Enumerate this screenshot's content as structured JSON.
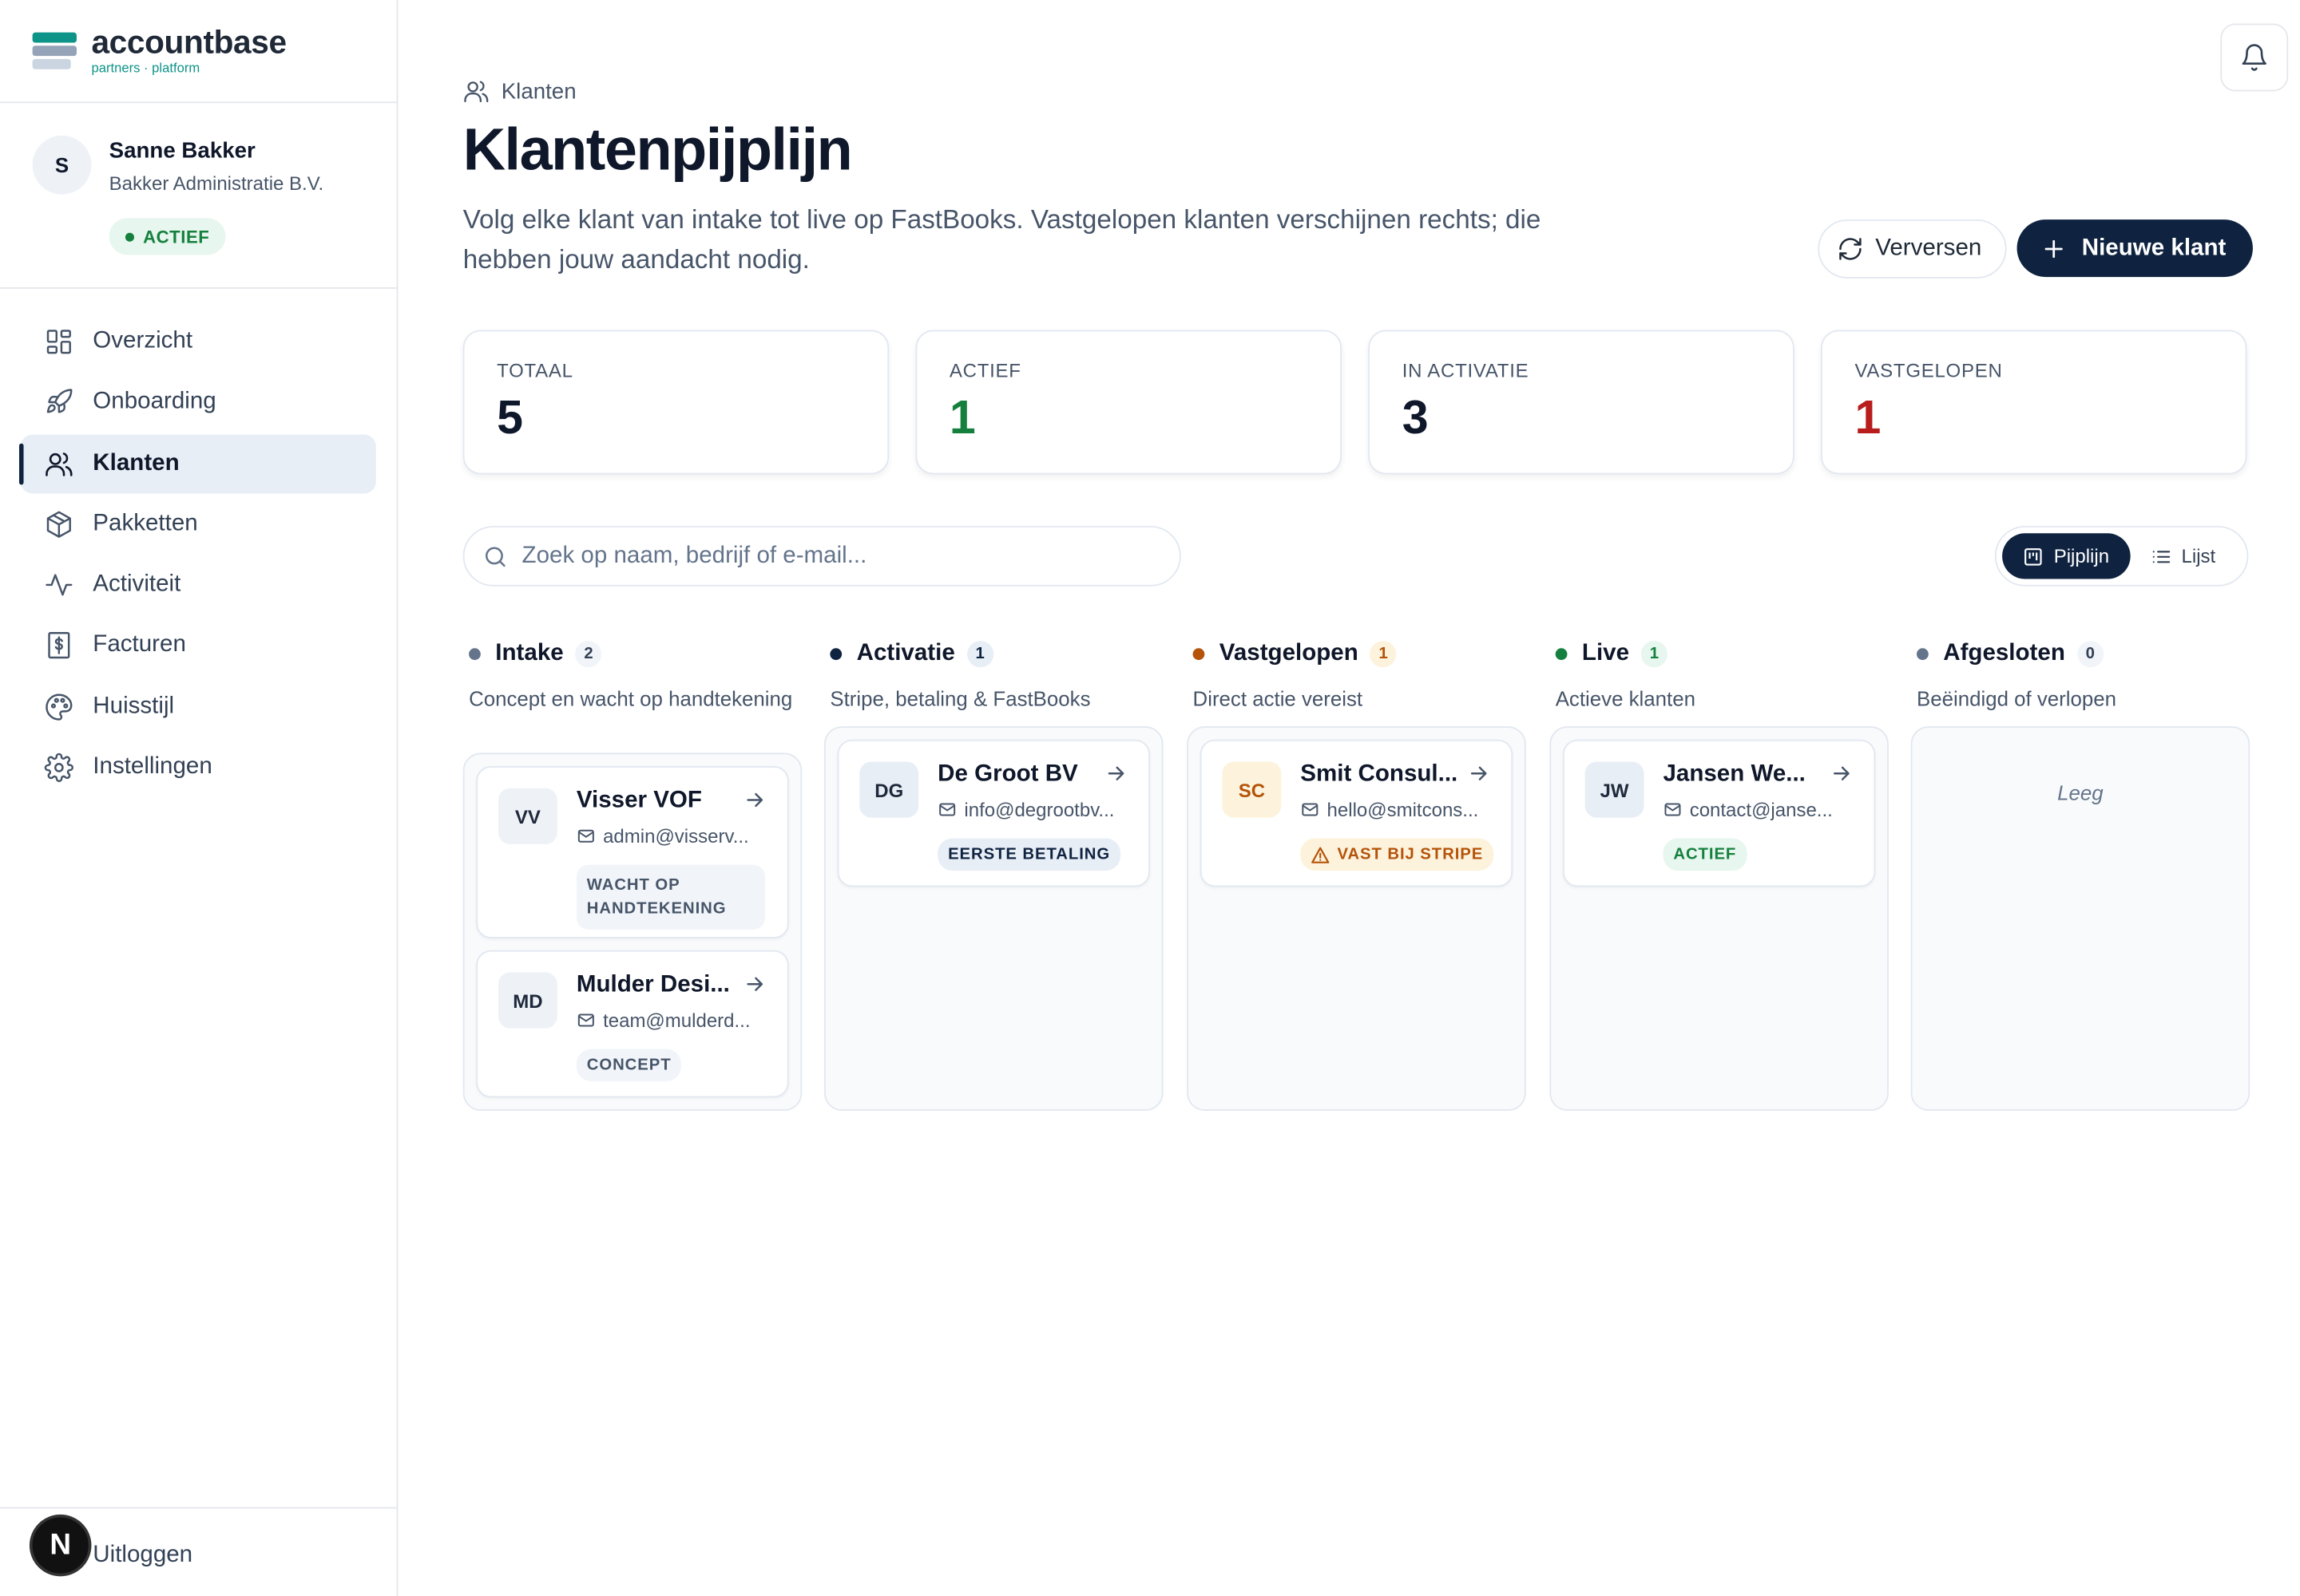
{
  "brand": {
    "name": "accountbase",
    "tagline": "partners · platform"
  },
  "user": {
    "initial": "S",
    "name": "Sanne Bakker",
    "org": "Bakker Administratie B.V.",
    "status": "ACTIEF"
  },
  "nav": {
    "items": [
      {
        "label": "Overzicht",
        "icon": "grid-icon"
      },
      {
        "label": "Onboarding",
        "icon": "rocket-icon"
      },
      {
        "label": "Klanten",
        "icon": "users-icon",
        "active": true
      },
      {
        "label": "Pakketten",
        "icon": "package-icon"
      },
      {
        "label": "Activiteit",
        "icon": "activity-icon"
      },
      {
        "label": "Facturen",
        "icon": "receipt-icon"
      },
      {
        "label": "Huisstijl",
        "icon": "palette-icon"
      },
      {
        "label": "Instellingen",
        "icon": "gear-icon"
      }
    ],
    "logout": "Uitloggen",
    "dev_badge": "N"
  },
  "header": {
    "breadcrumb": "Klanten",
    "title": "Klantenpijplijn",
    "subtitle": "Volg elke klant van intake tot live op FastBooks. Vastgelopen klanten verschijnen rechts; die hebben jouw aandacht nodig.",
    "refresh_label": "Verversen",
    "new_label": "Nieuwe klant"
  },
  "stats": [
    {
      "label": "TOTAAL",
      "value": "5",
      "color": "#0f172a"
    },
    {
      "label": "ACTIEF",
      "value": "1",
      "color": "#15803d"
    },
    {
      "label": "IN ACTIVATIE",
      "value": "3",
      "color": "#0f172a"
    },
    {
      "label": "VASTGELOPEN",
      "value": "1",
      "color": "#b91c1c"
    }
  ],
  "search": {
    "placeholder": "Zoek op naam, bedrijf of e-mail..."
  },
  "view_toggle": {
    "board": "Pijplijn",
    "list": "Lijst",
    "selected": "Pijplijn"
  },
  "columns": [
    {
      "name": "Intake",
      "count": "2",
      "description": "Concept en wacht op handtekening",
      "dot": "#64748b",
      "cards": [
        {
          "initials": "VV",
          "name": "Visser VOF",
          "email": "admin@visserv...",
          "status": "WACHT OP HANDTEKENING"
        },
        {
          "initials": "MD",
          "name": "Mulder Desi...",
          "email": "team@mulderd...",
          "status": "CONCEPT"
        }
      ]
    },
    {
      "name": "Activatie",
      "count": "1",
      "description": "Stripe, betaling & FastBooks",
      "dot": "#0f2340",
      "cards": [
        {
          "initials": "DG",
          "name": "De Groot BV",
          "email": "info@degrootbv...",
          "status": "EERSTE BETALING"
        }
      ]
    },
    {
      "name": "Vastgelopen",
      "count": "1",
      "description": "Direct actie vereist",
      "dot": "#b45309",
      "cards": [
        {
          "initials": "SC",
          "name": "Smit Consul...",
          "email": "hello@smitcons...",
          "status": "VAST BIJ STRIPE"
        }
      ]
    },
    {
      "name": "Live",
      "count": "1",
      "description": "Actieve klanten",
      "dot": "#15803d",
      "cards": [
        {
          "initials": "JW",
          "name": "Jansen We...",
          "email": "contact@janse...",
          "status": "ACTIEF"
        }
      ]
    },
    {
      "name": "Afgesloten",
      "count": "0",
      "description": "Beëindigd of verlopen",
      "dot": "#64748b",
      "cards": [],
      "empty_label": "Leeg"
    }
  ],
  "colors": {
    "primary": "#0f2340",
    "accent": "#0d9488",
    "success": "#15803d",
    "danger": "#b91c1c",
    "warning": "#b45309"
  }
}
